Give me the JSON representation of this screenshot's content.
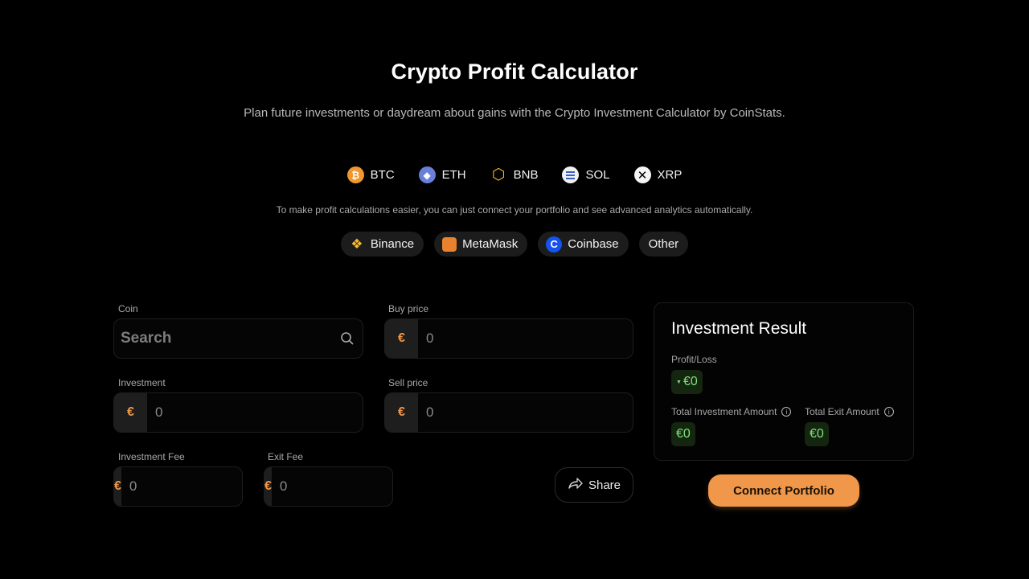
{
  "header": {
    "title": "Crypto Profit Calculator",
    "subtitle": "Plan future investments or daydream about gains with the Crypto Investment Calculator by CoinStats."
  },
  "coins": [
    {
      "symbol": "BTC",
      "icon": "bitcoin-icon",
      "glyph": "₿"
    },
    {
      "symbol": "ETH",
      "icon": "ethereum-icon",
      "glyph": "◆"
    },
    {
      "symbol": "BNB",
      "icon": "bnb-icon",
      "glyph": "⬡"
    },
    {
      "symbol": "SOL",
      "icon": "solana-icon",
      "glyph": "≡"
    },
    {
      "symbol": "XRP",
      "icon": "xrp-icon",
      "glyph": "✕"
    }
  ],
  "hint": "To make profit calculations easier, you can just connect your portfolio and see advanced analytics automatically.",
  "wallets": [
    {
      "label": "Binance",
      "icon": "binance-icon",
      "glyph": "❖"
    },
    {
      "label": "MetaMask",
      "icon": "metamask-icon",
      "glyph": ""
    },
    {
      "label": "Coinbase",
      "icon": "coinbase-icon",
      "glyph": "C"
    },
    {
      "label": "Other",
      "icon": "",
      "glyph": ""
    }
  ],
  "form": {
    "coin": {
      "label": "Coin",
      "placeholder": "Search",
      "value": ""
    },
    "buy_price": {
      "label": "Buy price",
      "currency": "€",
      "placeholder": "0"
    },
    "investment": {
      "label": "Investment",
      "currency": "€",
      "placeholder": "0"
    },
    "sell_price": {
      "label": "Sell price",
      "currency": "€",
      "placeholder": "0"
    },
    "investment_fee": {
      "label": "Investment Fee",
      "currency": "€",
      "placeholder": "0"
    },
    "exit_fee": {
      "label": "Exit Fee",
      "currency": "€",
      "placeholder": "0"
    },
    "share_label": "Share"
  },
  "result": {
    "title": "Investment Result",
    "profit_loss_label": "Profit/Loss",
    "profit_loss_value": "€0",
    "total_investment_label": "Total Investment Amount",
    "total_investment_value": "€0",
    "total_exit_label": "Total Exit Amount",
    "total_exit_value": "€0",
    "info_glyph": "i",
    "trend_glyph": "▼"
  },
  "connect_label": "Connect Portfolio",
  "colors": {
    "accent": "#f0974a",
    "positive": "#7ee37a",
    "background": "#000000"
  }
}
